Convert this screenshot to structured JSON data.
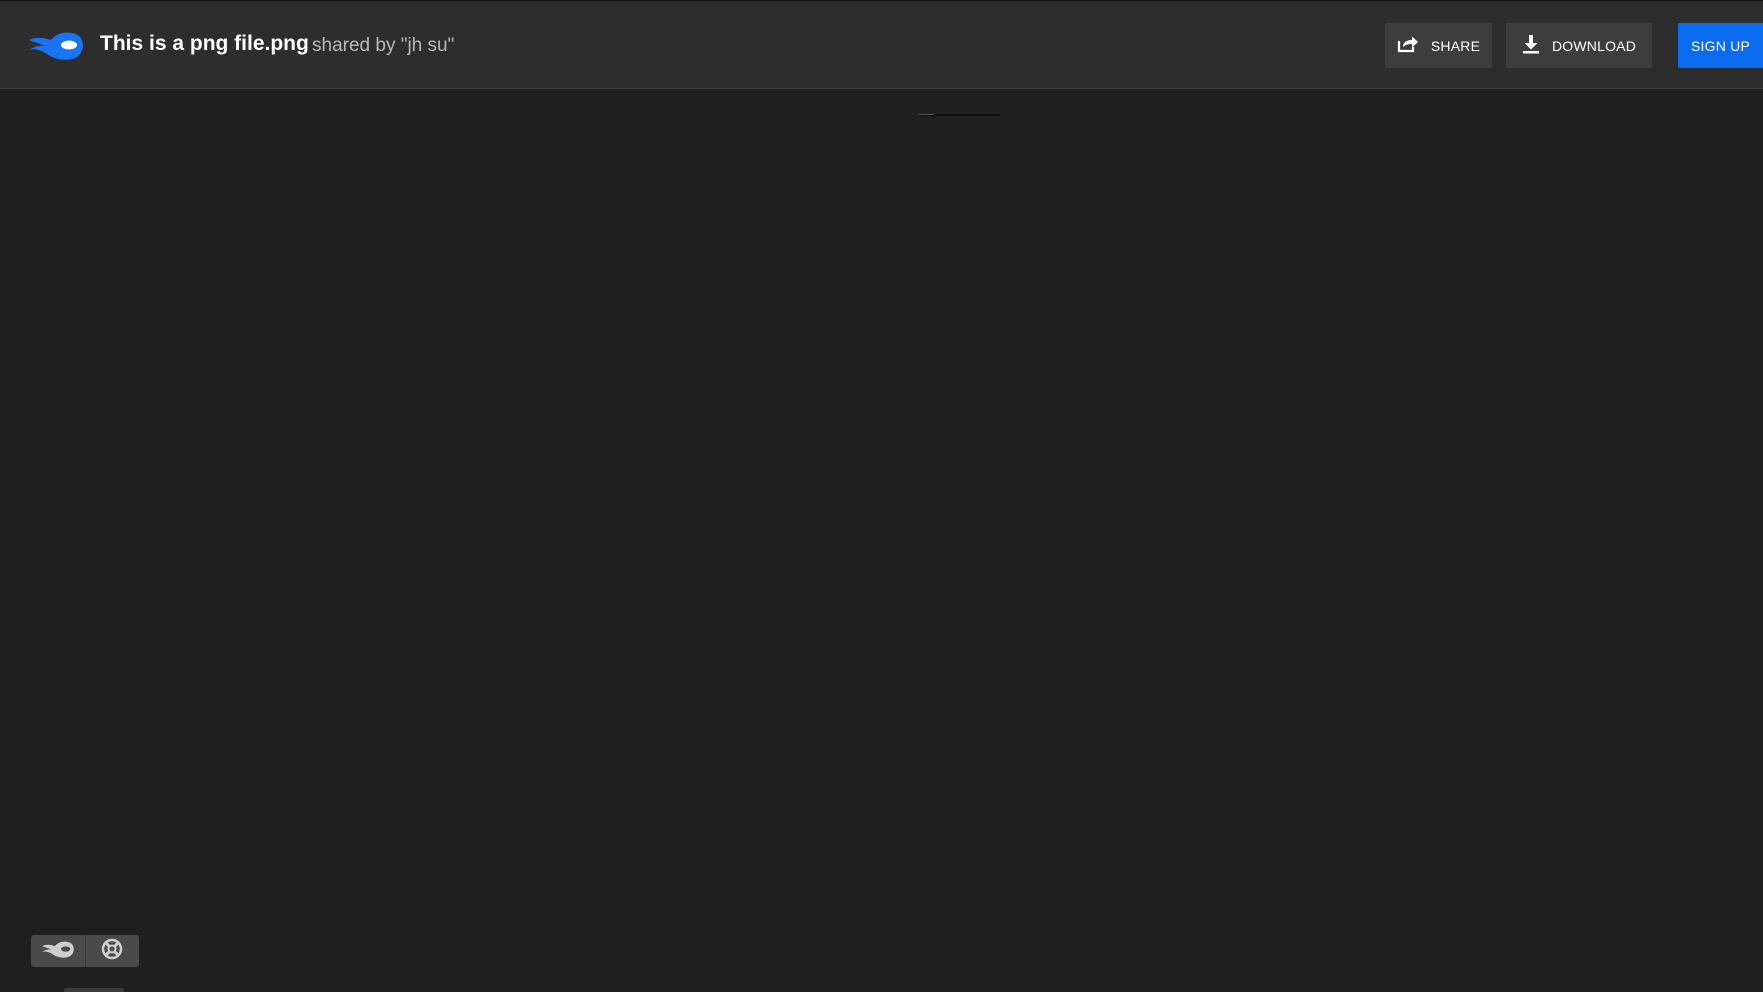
{
  "header": {
    "file_title": "This is a png file.png",
    "shared_by": "shared by \"jh su\"",
    "logo_icon": "mediafire-flame-icon"
  },
  "toolbar": {
    "share_label": "SHARE",
    "share_icon": "share-icon",
    "download_label": "DOWNLOAD",
    "download_icon": "download-icon",
    "signup_label": "SIGN UP"
  },
  "colors": {
    "topbar_bg": "#2d2d2d",
    "page_bg": "#1f1f1f",
    "button_bg": "#3d3d3d",
    "accent": "#0a6bef",
    "logo_blue": "#1a73f0"
  },
  "footer_widget": {
    "logo_icon": "mediafire-flame-icon",
    "help_icon": "lifebuoy-icon"
  }
}
